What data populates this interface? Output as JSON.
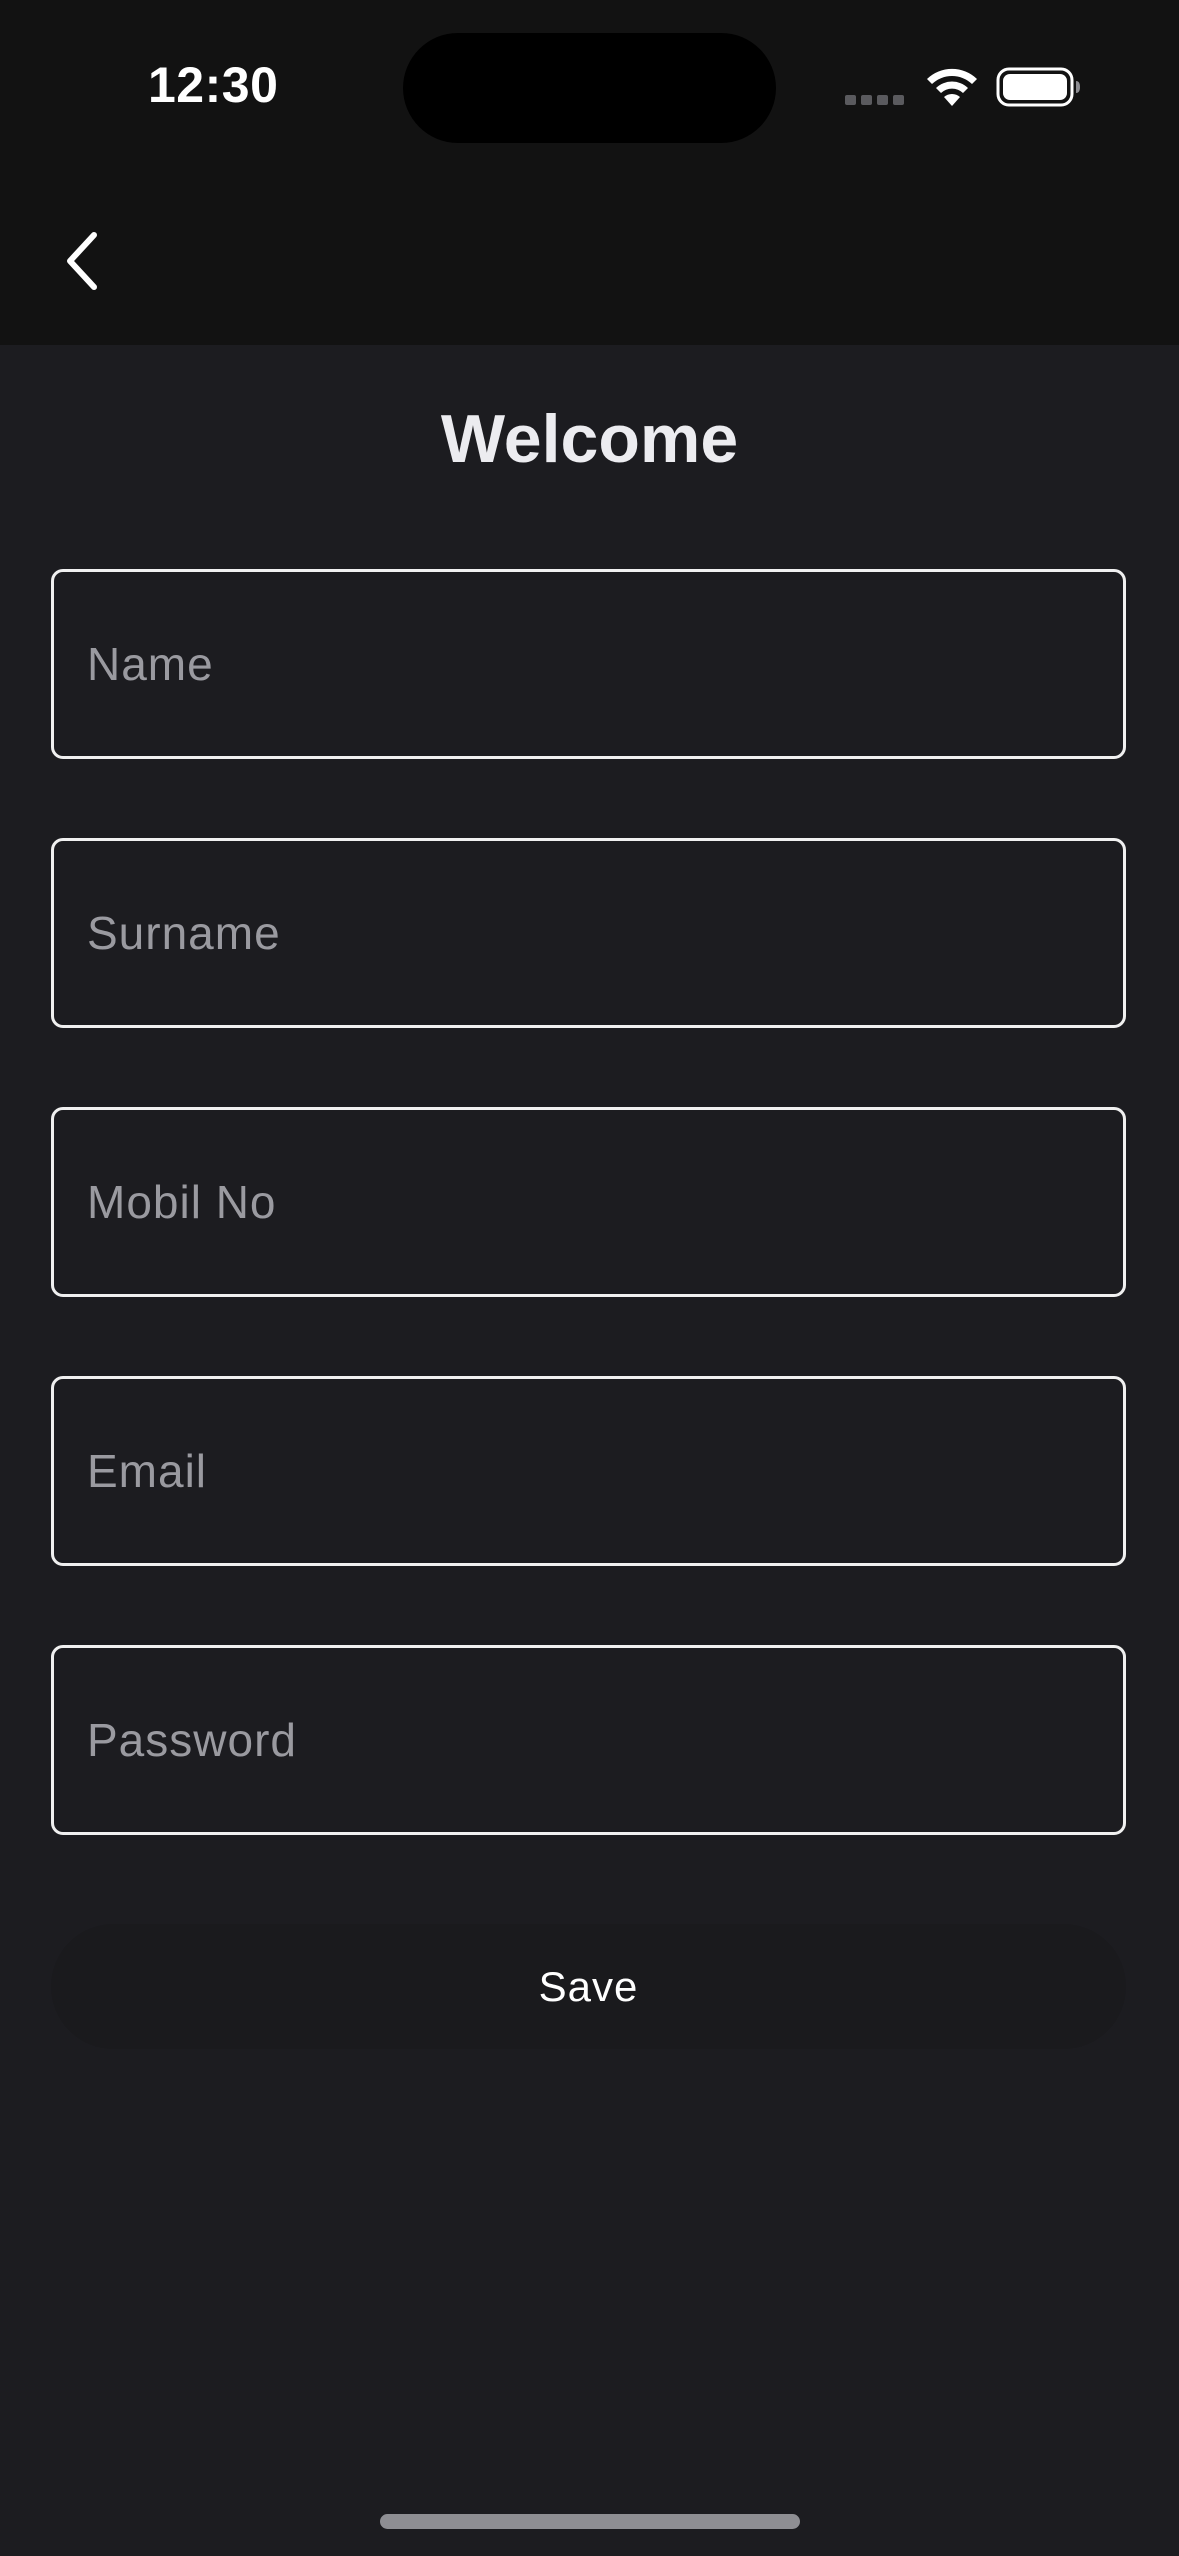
{
  "status_bar": {
    "time": "12:30"
  },
  "nav": {
    "back_icon": "chevron-left-icon"
  },
  "title": "Welcome",
  "form": {
    "name_placeholder": "Name",
    "surname_placeholder": "Surname",
    "mobile_placeholder": "Mobil No",
    "email_placeholder": "Email",
    "password_placeholder": "Password"
  },
  "save_label": "Save",
  "colors": {
    "background": "#1c1c20",
    "header": "#121212",
    "field_border": "#f0f0f0",
    "placeholder": "#9a9aa0"
  }
}
